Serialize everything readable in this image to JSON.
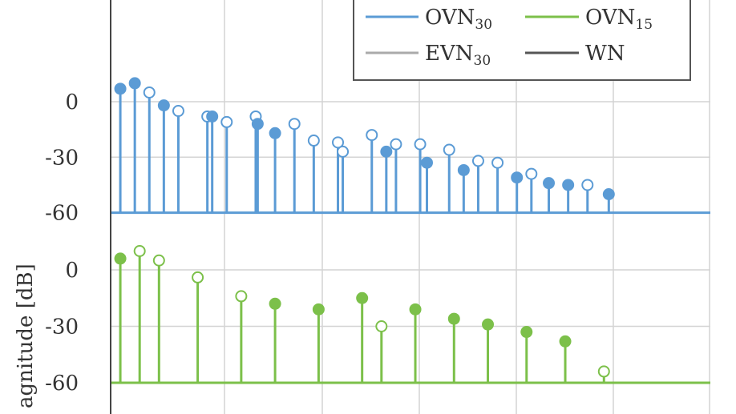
{
  "chart_data": {
    "type": "stem",
    "ylabel": "agnitude [dB]",
    "xlim": [
      0,
      62
    ],
    "grid": true,
    "legend_placement": "top-right",
    "colors": {
      "blue": "#5b9bd5",
      "blue_dark": "#4a8ac6",
      "green": "#7cc04a",
      "green_dark": "#6aae3a",
      "evn": "#aaaaaa",
      "wn": "#555555",
      "grid": "#d4d4d4",
      "axis": "#444444",
      "legend_border": "#555555"
    },
    "legend": [
      {
        "base": "OVN",
        "sub": "30",
        "color": "#5b9bd5"
      },
      {
        "base": "OVN",
        "sub": "15",
        "color": "#7cc04a"
      },
      {
        "base": "EVN",
        "sub": "30",
        "color": "#aaaaaa"
      },
      {
        "base": "WN",
        "sub": "",
        "color": "#555555"
      }
    ],
    "panels": [
      {
        "name": "top",
        "baseline": -60,
        "ylim": [
          -60,
          60
        ],
        "yticks": [
          0,
          -30,
          -60
        ],
        "ytick_labels": [
          "0",
          "-30",
          "-60"
        ],
        "series_color": "#5b9bd5",
        "stems": [
          {
            "x": 1,
            "y": 7,
            "filled": true
          },
          {
            "x": 2.5,
            "y": 10,
            "filled": true
          },
          {
            "x": 4,
            "y": 5,
            "filled": false
          },
          {
            "x": 5.5,
            "y": -2,
            "filled": true
          },
          {
            "x": 7,
            "y": -5,
            "filled": false
          },
          {
            "x": 10,
            "y": -8,
            "filled": false
          },
          {
            "x": 10.5,
            "y": -8,
            "filled": true
          },
          {
            "x": 12,
            "y": -11,
            "filled": false
          },
          {
            "x": 15,
            "y": -8,
            "filled": false
          },
          {
            "x": 15.2,
            "y": -12,
            "filled": true
          },
          {
            "x": 17,
            "y": -17,
            "filled": true
          },
          {
            "x": 19,
            "y": -12,
            "filled": false
          },
          {
            "x": 21,
            "y": -21,
            "filled": false
          },
          {
            "x": 23.5,
            "y": -22,
            "filled": false
          },
          {
            "x": 24,
            "y": -27,
            "filled": false
          },
          {
            "x": 27,
            "y": -18,
            "filled": false
          },
          {
            "x": 28.5,
            "y": -27,
            "filled": true
          },
          {
            "x": 29.5,
            "y": -23,
            "filled": false
          },
          {
            "x": 32,
            "y": -23,
            "filled": false
          },
          {
            "x": 32.7,
            "y": -33,
            "filled": true
          },
          {
            "x": 35,
            "y": -26,
            "filled": false
          },
          {
            "x": 36.5,
            "y": -37,
            "filled": true
          },
          {
            "x": 38,
            "y": -32,
            "filled": false
          },
          {
            "x": 40,
            "y": -33,
            "filled": false
          },
          {
            "x": 42,
            "y": -41,
            "filled": true
          },
          {
            "x": 43.5,
            "y": -39,
            "filled": false
          },
          {
            "x": 45.3,
            "y": -44,
            "filled": true
          },
          {
            "x": 47.3,
            "y": -45,
            "filled": true
          },
          {
            "x": 49.3,
            "y": -45,
            "filled": false
          },
          {
            "x": 51.5,
            "y": -50,
            "filled": true
          }
        ]
      },
      {
        "name": "bottom",
        "baseline": -60,
        "ylim": [
          -60,
          60
        ],
        "yticks": [
          0,
          -30,
          -60
        ],
        "ytick_labels": [
          "0",
          "-30",
          "-60"
        ],
        "series_color": "#7cc04a",
        "stems": [
          {
            "x": 1,
            "y": 6,
            "filled": true
          },
          {
            "x": 3,
            "y": 10,
            "filled": false
          },
          {
            "x": 5,
            "y": 5,
            "filled": false
          },
          {
            "x": 9,
            "y": -4,
            "filled": false
          },
          {
            "x": 13.5,
            "y": -14,
            "filled": false
          },
          {
            "x": 17,
            "y": -18,
            "filled": true
          },
          {
            "x": 21.5,
            "y": -21,
            "filled": true
          },
          {
            "x": 26,
            "y": -15,
            "filled": true
          },
          {
            "x": 28,
            "y": -30,
            "filled": false
          },
          {
            "x": 31.5,
            "y": -21,
            "filled": true
          },
          {
            "x": 35.5,
            "y": -26,
            "filled": true
          },
          {
            "x": 39,
            "y": -29,
            "filled": true
          },
          {
            "x": 43,
            "y": -33,
            "filled": true
          },
          {
            "x": 47,
            "y": -38,
            "filled": true
          },
          {
            "x": 51,
            "y": -54,
            "filled": false
          }
        ]
      }
    ]
  }
}
